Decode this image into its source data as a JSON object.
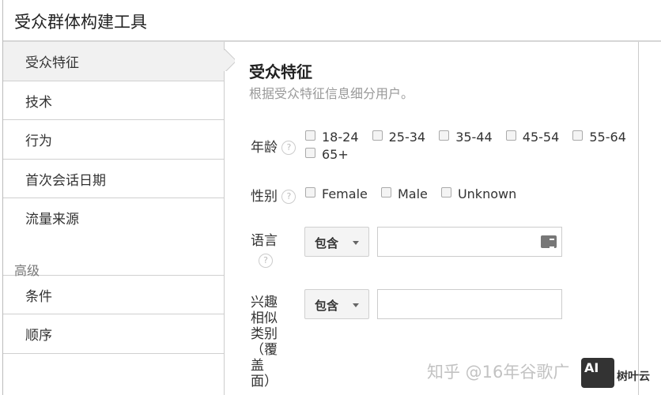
{
  "title": "受众群体构建工具",
  "sidebar": {
    "items": [
      {
        "label": "受众特征"
      },
      {
        "label": "技术"
      },
      {
        "label": "行为"
      },
      {
        "label": "首次会话日期"
      },
      {
        "label": "流量来源"
      }
    ],
    "advanced_heading": "高级",
    "advanced_items": [
      {
        "label": "条件"
      },
      {
        "label": "顺序"
      }
    ]
  },
  "main": {
    "heading": "受众特征",
    "subtitle": "根据受众特征信息细分用户。",
    "age": {
      "label": "年龄",
      "options": [
        "18-24",
        "25-34",
        "35-44",
        "45-54",
        "55-64",
        "65+"
      ]
    },
    "gender": {
      "label": "性别",
      "options": [
        "Female",
        "Male",
        "Unknown"
      ]
    },
    "language": {
      "label": "语言",
      "operator": "包含",
      "value": ""
    },
    "interest": {
      "label": "兴趣相似类别（覆盖面）",
      "operator": "包含",
      "value": ""
    },
    "help": "?"
  },
  "watermark": {
    "text": "知乎 @16年谷歌广",
    "logo": "AI",
    "logo_text": "树叶云"
  }
}
